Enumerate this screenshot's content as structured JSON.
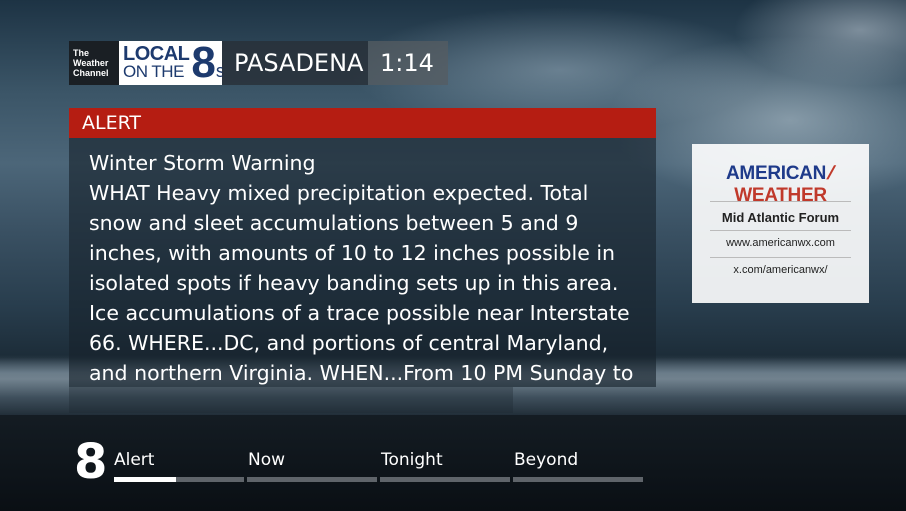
{
  "header": {
    "twc_logo": [
      "The",
      "Weather",
      "Channel"
    ],
    "local_logo": {
      "line1": "LOCAL",
      "line2": "ON THE",
      "number": "8",
      "suffix": "s"
    },
    "city": "PASADENA",
    "time": "1:14"
  },
  "alert": {
    "label": "ALERT",
    "title": "Winter Storm Warning",
    "body": "WHAT Heavy mixed precipitation expected. Total snow and sleet accumulations between 5 and 9 inches, with amounts of 10 to 12 inches possible in isolated spots if heavy banding sets up in this area. Ice accumulations of a trace possible near Interstate 66. WHERE...DC, and portions of central Maryland, and northern Virginia. WHEN...From 10 PM Sunday to"
  },
  "ad": {
    "brand_left": "AMERICAN",
    "brand_right": "WEATHER",
    "forum": "Mid Atlantic Forum",
    "url1": "www.americanwx.com",
    "url2": "x.com/americanwx/"
  },
  "nav": {
    "number": "8",
    "tabs": [
      {
        "label": "Alert",
        "progress": 0.48
      },
      {
        "label": "Now",
        "progress": 0
      },
      {
        "label": "Tonight",
        "progress": 0
      },
      {
        "label": "Beyond",
        "progress": 0
      }
    ]
  },
  "colors": {
    "alert_red": "#b51d12",
    "brand_blue": "#1e3a8a",
    "brand_red": "#c0392b"
  }
}
